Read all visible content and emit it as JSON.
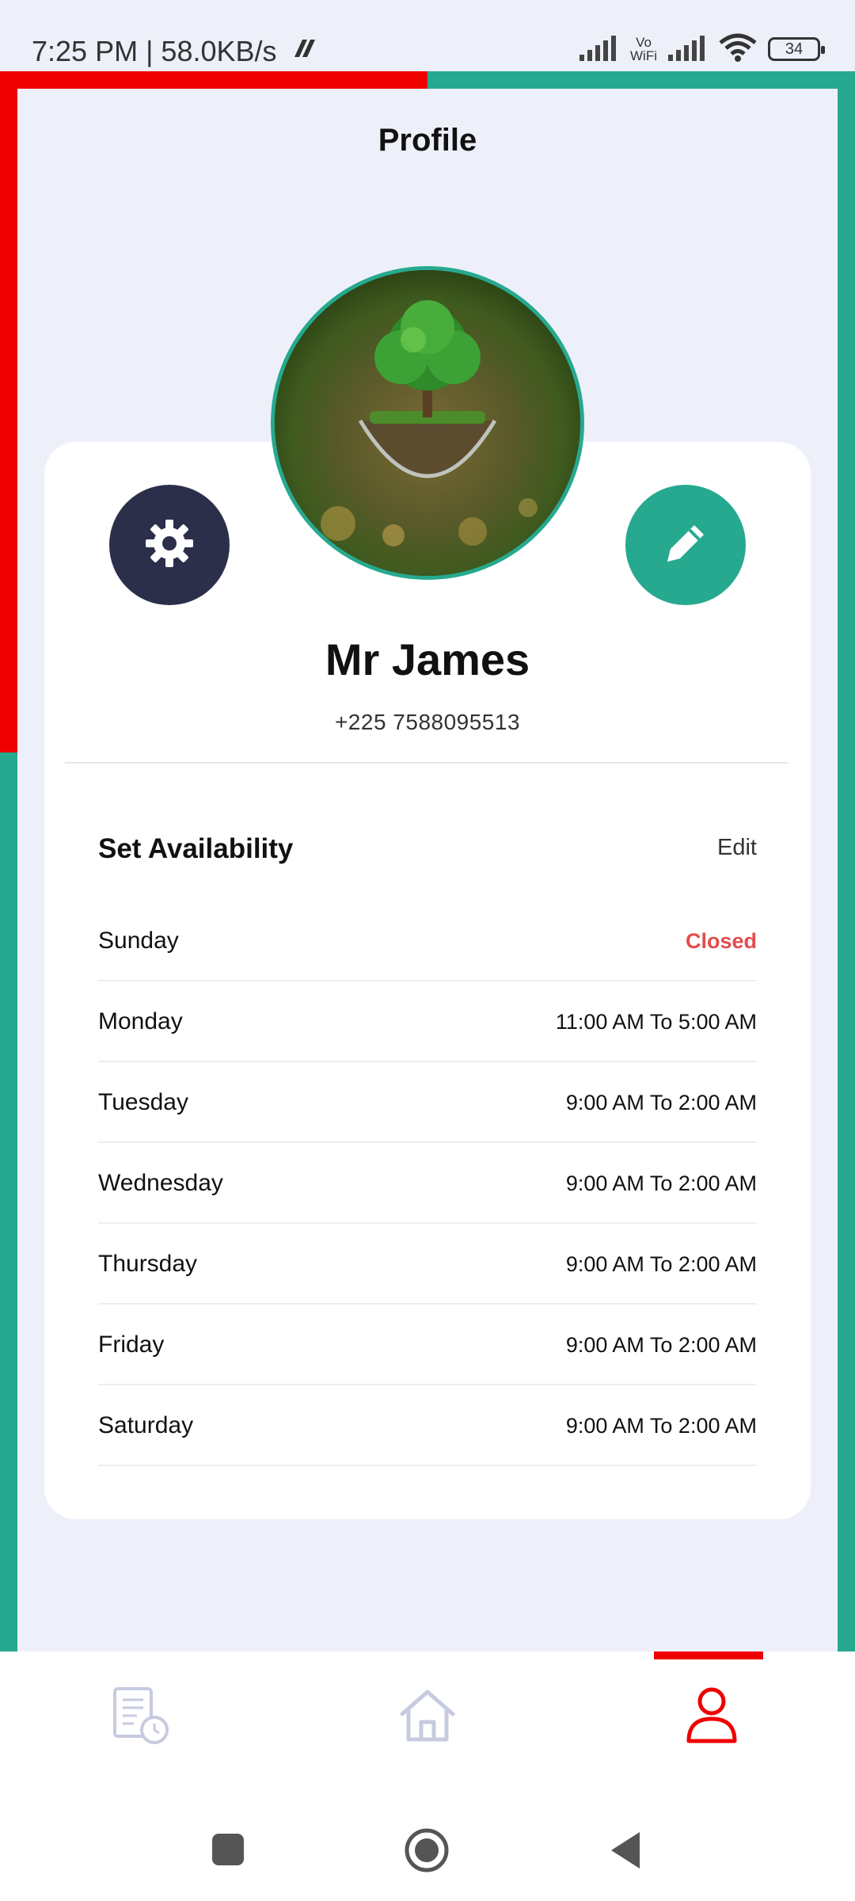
{
  "status_bar": {
    "time_speed": "7:25 PM | 58.0KB/s",
    "vowifi_label_1": "Vo",
    "vowifi_label_2": "WiFi",
    "battery": "34"
  },
  "header": {
    "title": "Profile"
  },
  "profile": {
    "name": "Mr James",
    "phone": "+225 7588095513"
  },
  "availability": {
    "title": "Set Availability",
    "edit_label": "Edit",
    "days": [
      {
        "day": "Sunday",
        "hours": "Closed",
        "closed": true
      },
      {
        "day": "Monday",
        "hours": "11:00 AM To 5:00 AM",
        "closed": false
      },
      {
        "day": "Tuesday",
        "hours": "9:00 AM To 2:00 AM",
        "closed": false
      },
      {
        "day": "Wednesday",
        "hours": "9:00 AM To 2:00 AM",
        "closed": false
      },
      {
        "day": "Thursday",
        "hours": "9:00 AM To 2:00 AM",
        "closed": false
      },
      {
        "day": "Friday",
        "hours": "9:00 AM To 2:00 AM",
        "closed": false
      },
      {
        "day": "Saturday",
        "hours": "9:00 AM To 2:00 AM",
        "closed": false
      }
    ]
  },
  "bottom_nav": {
    "items": [
      {
        "icon": "history-icon",
        "active": false
      },
      {
        "icon": "home-icon",
        "active": false
      },
      {
        "icon": "profile-icon",
        "active": true
      }
    ],
    "active_color": "#ee0000",
    "inactive_color": "#c7cbe0"
  },
  "colors": {
    "accent_teal": "#26a98f",
    "accent_red": "#ee0000",
    "settings_bg": "#2b2f4a",
    "closed_text": "#e24d4d",
    "page_bg": "#eef0f9"
  }
}
